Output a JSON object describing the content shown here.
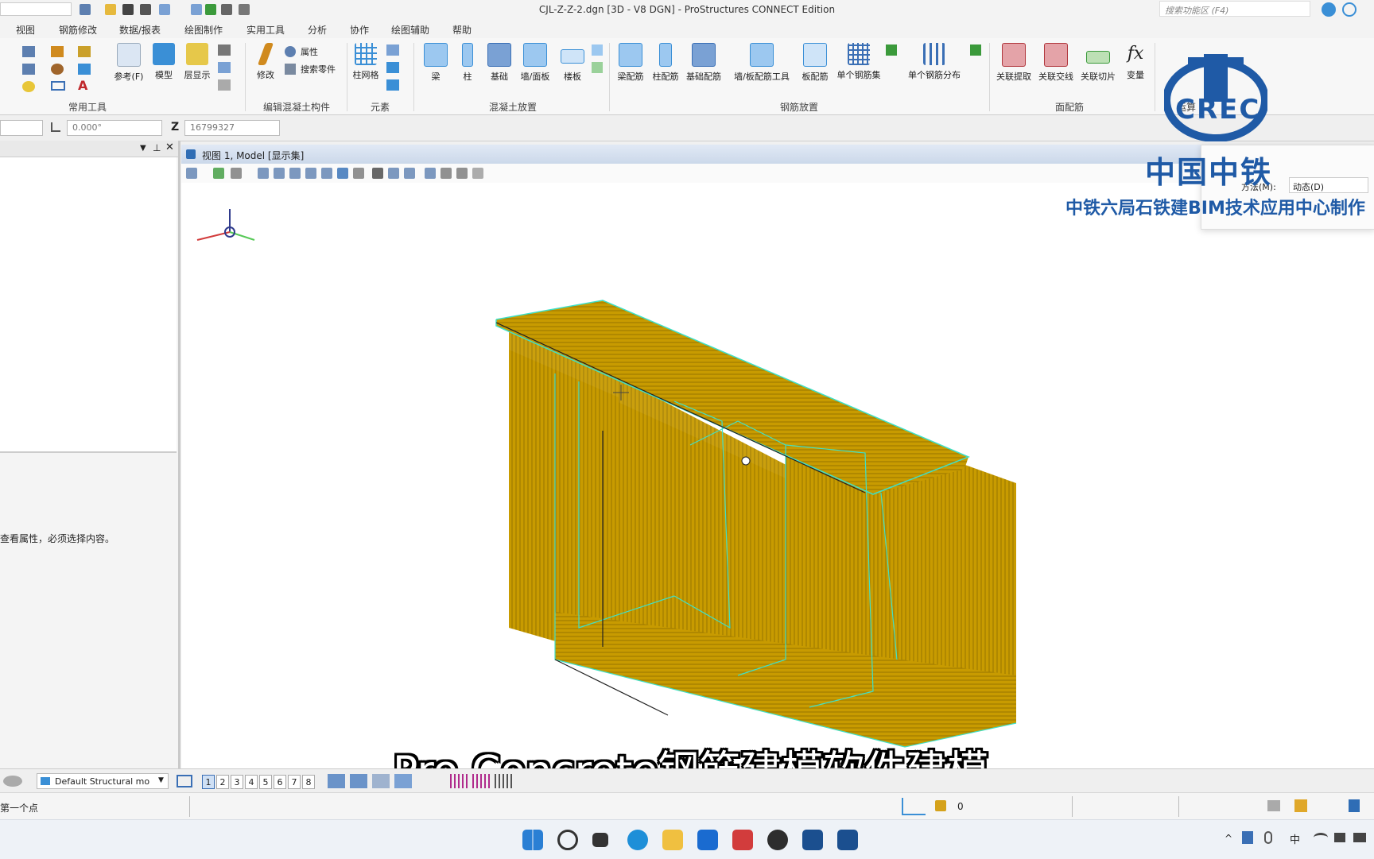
{
  "window": {
    "title": "CJL-Z-Z-2.dgn [3D - V8 DGN] - ProStructures CONNECT Edition",
    "search_placeholder": "搜索功能区 (F4)"
  },
  "menu_tabs": [
    "视图",
    "钢筋修改",
    "数据/报表",
    "绘图制作",
    "实用工具",
    "分析",
    "协作",
    "绘图辅助",
    "帮助"
  ],
  "ribbon": {
    "common": {
      "title": "常用工具",
      "reference": "参考(F)",
      "model": "模型",
      "levels": "层显示"
    },
    "edit_concrete": {
      "title": "编辑混凝土构件",
      "modify": "修改",
      "properties": "属性",
      "search_parts": "搜索零件"
    },
    "elements": {
      "title": "元素",
      "column_grid": "柱网格"
    },
    "concrete_placement": {
      "title": "混凝土放置",
      "beam": "梁",
      "column": "柱",
      "foundation": "基础",
      "wall_panel": "墙/面板",
      "floor": "楼板"
    },
    "rebar_placement": {
      "title": "钢筋放置",
      "beam_rebar": "梁配筋",
      "column_rebar": "柱配筋",
      "foundation_rebar": "基础配筋",
      "wall_slab_tool": "墙/板配筋工具",
      "slab_rebar": "板配筋",
      "single_rebar_set": "单个钢筋集",
      "single_rebar_distribution": "单个钢筋分布"
    },
    "section_rebar": {
      "title": "面配筋",
      "link_extract": "关联提取",
      "link_intersect": "关联交线",
      "link_slice": "关联切片",
      "variable": "变量"
    },
    "calc": {
      "title_partial": "运算"
    }
  },
  "coords": {
    "angle": "0.000°",
    "z_label": "Z",
    "z_value": "16799327"
  },
  "left_panel": {
    "message": "查看属性，必须选择内容。"
  },
  "view": {
    "title": "视图 1, Model [显示集]"
  },
  "floating_dialog": {
    "method_label": "方法(M):",
    "method_value": "动态(D)"
  },
  "bottom": {
    "view_model": "Default Structural mo",
    "pages": [
      "1",
      "2",
      "3",
      "4",
      "5",
      "6",
      "7",
      "8"
    ],
    "active_page": "1"
  },
  "status": {
    "prompt": "第一个点",
    "lock_value": "0"
  },
  "watermark": {
    "org": "中国中铁",
    "maker": "中铁六局石铁建BIM技术应用中心制作",
    "logo_text": "CREC"
  },
  "subtitle": "Pro Concrete钢筋建模软件建模",
  "colors": {
    "rebar_fill": "#c89b00",
    "rebar_edge": "#3fe0c8",
    "brand_blue": "#1f5aa6",
    "ribbon_icon": "#3a8fd6"
  }
}
